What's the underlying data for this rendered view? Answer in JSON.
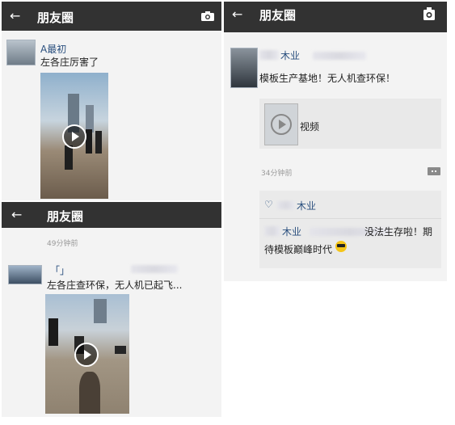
{
  "panel_a": {
    "back_icon": "back-arrow-icon",
    "title": "朋友圈",
    "camera_icon": "camera-icon",
    "post": {
      "user": "A最初",
      "text": "左各庄厉害了"
    }
  },
  "panel_b": {
    "back_icon": "back-arrow-icon",
    "title": "朋友圈",
    "camera_icon": "camera-icon",
    "time": "49分钟前",
    "post": {
      "user": "「」",
      "text": "左各庄查环保，无人机已起飞..."
    }
  },
  "panel_c": {
    "back_icon": "back-arrow-icon",
    "title": "朋友圈",
    "camera_icon": "camera-icon",
    "post": {
      "user": "木业",
      "text": "模板生产基地！无人机查环保！",
      "video_label": "视频",
      "time": "34分钟前"
    },
    "like": {
      "heart_icon": "heart-icon",
      "user": "木业"
    },
    "comment": {
      "user": "木业",
      "text_line1": "没法生存啦！期",
      "text_line2": "待模板巅峰时代"
    }
  }
}
